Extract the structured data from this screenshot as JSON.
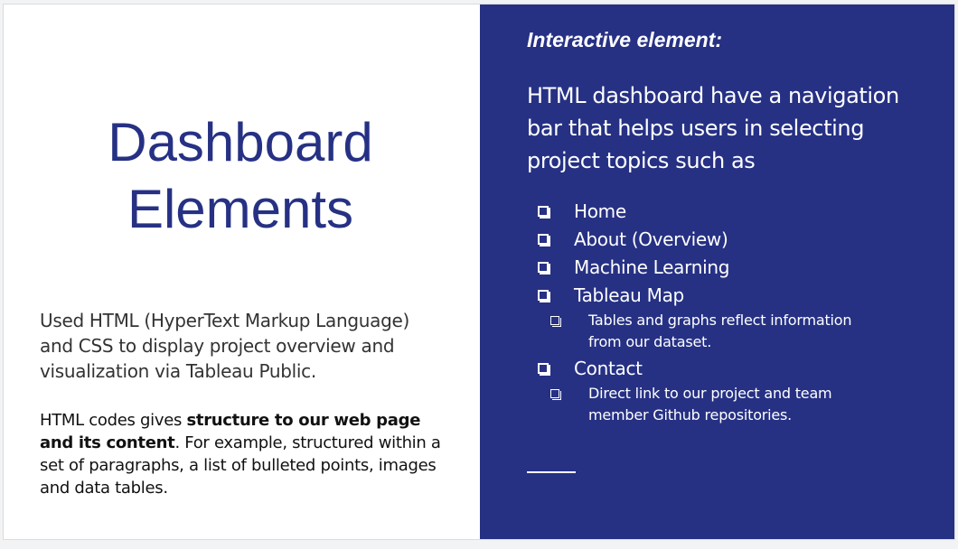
{
  "left": {
    "title_line1": "Dashboard",
    "title_line2": "Elements",
    "paragraph1": "Used HTML (HyperText Markup Language) and CSS to display project overview and visualization via Tableau Public.",
    "paragraph2": {
      "prefix": "HTML codes gives ",
      "bold": "structure to our web page and its content",
      "suffix": ". For example, structured within a set of paragraphs, a list of bulleted points, images and data tables."
    }
  },
  "right": {
    "heading": "Interactive element:",
    "intro": "HTML dashboard have a navigation bar that helps users in selecting project topics such as",
    "items": [
      {
        "label": "Home"
      },
      {
        "label": "About (Overview)"
      },
      {
        "label": "Machine Learning"
      },
      {
        "label": "Tableau Map",
        "sub": "Tables and graphs reflect information from our dataset."
      },
      {
        "label": "Contact",
        "sub": "Direct link to our  project and team member Github repositories."
      }
    ]
  },
  "colors": {
    "panel_background": "#263184",
    "title_color": "#263184",
    "text_on_panel": "#ffffff"
  },
  "icons": {
    "bullet": "shadowed-box-bullet-icon"
  }
}
